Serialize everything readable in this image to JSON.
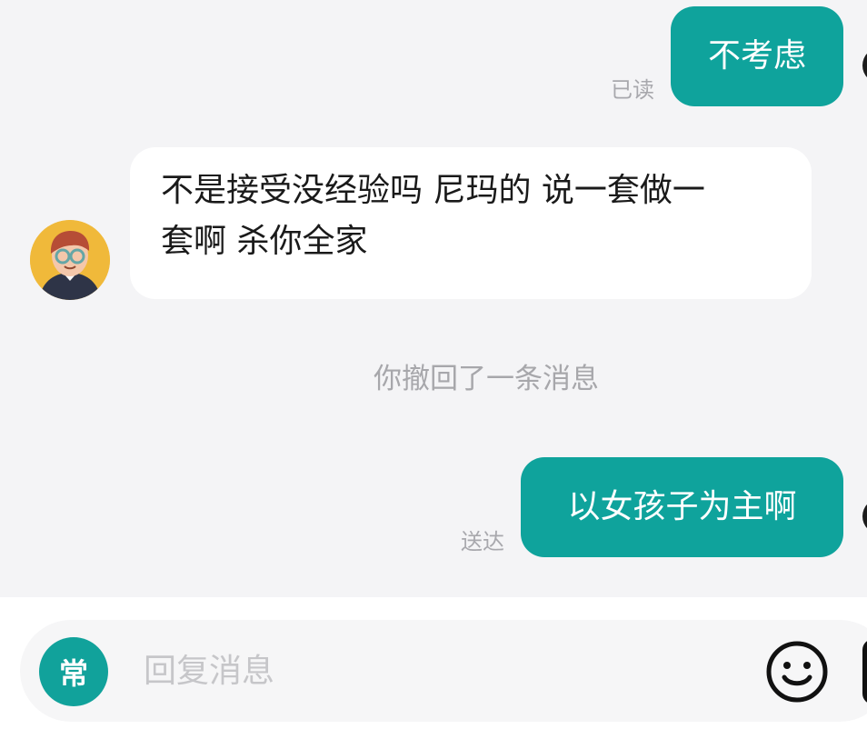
{
  "chat": {
    "messages": [
      {
        "id": "msg1",
        "direction": "outgoing",
        "text": "不考虑",
        "status": "已读"
      },
      {
        "id": "msg2",
        "direction": "incoming",
        "lines": [
          "不是接受没经验吗 尼玛的 说一套做一",
          "套啊 杀你全家"
        ]
      },
      {
        "id": "msg3",
        "direction": "system",
        "text": "你撤回了一条消息"
      },
      {
        "id": "msg4",
        "direction": "outgoing",
        "text": "以女孩子为主啊",
        "status": "送达"
      }
    ]
  },
  "input_bar": {
    "phrase_button_label": "常",
    "placeholder": "回复消息",
    "emoji_icon": "smile-icon"
  },
  "colors": {
    "background": "#f4f4f6",
    "outgoing_bubble": "#0fa39c",
    "incoming_bubble": "#ffffff",
    "status_text": "#a8a8ad",
    "phrase_button": "#11a29b"
  },
  "icons": {
    "contact_avatar": "person-avatar-icon",
    "own_avatar_edge": "avatar-icon",
    "emoji": "smile-icon"
  }
}
